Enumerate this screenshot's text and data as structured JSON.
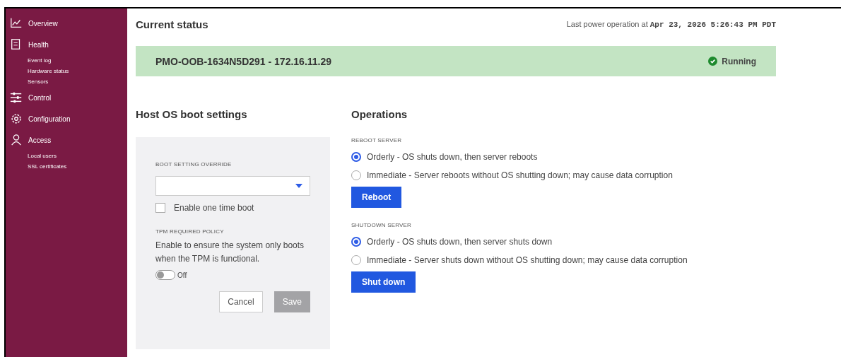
{
  "sidebar": {
    "items": [
      {
        "label": "Overview"
      },
      {
        "label": "Health",
        "children": [
          {
            "label": "Event log"
          },
          {
            "label": "Hardware status"
          },
          {
            "label": "Sensors"
          }
        ]
      },
      {
        "label": "Control"
      },
      {
        "label": "Configuration"
      },
      {
        "label": "Access",
        "children": [
          {
            "label": "Local users"
          },
          {
            "label": "SSL certificates"
          }
        ]
      }
    ]
  },
  "current_status": {
    "title": "Current status",
    "last_power_label": "Last power operation at",
    "last_power_time": "Apr 23, 2026 5:26:43 PM PDT",
    "host": "PMO-OOB-1634N5D291 - 172.16.11.29",
    "state": "Running",
    "healthy": true
  },
  "boot_settings": {
    "title": "Host OS boot settings",
    "override_label": "BOOT SETTING OVERRIDE",
    "one_time_boot": {
      "label": "Enable one time boot",
      "checked": false
    },
    "tpm_label": "TPM REQUIRED POLICY",
    "tpm_text": "Enable to ensure the system only boots when the TPM is functional.",
    "tpm_toggle": {
      "label": "Off",
      "on": false
    },
    "buttons": [
      {
        "label": "Cancel",
        "disabled": false
      },
      {
        "label": "Save",
        "disabled": true
      }
    ]
  },
  "operations": {
    "title": "Operations",
    "groups": [
      {
        "label": "REBOOT SERVER",
        "options": [
          {
            "label": "Orderly - OS shuts down, then server reboots",
            "selected": true
          },
          {
            "label": "Immediate - Server reboots without OS shutting down; may cause data corruption",
            "selected": false
          }
        ],
        "button": "Reboot"
      },
      {
        "label": "SHUTDOWN SERVER",
        "options": [
          {
            "label": "Orderly - OS shuts down, then server shuts down",
            "selected": true
          },
          {
            "label": "Immediate - Server shuts down without OS shutting down; may cause data corruption",
            "selected": false
          }
        ],
        "button": "Shut down"
      }
    ]
  }
}
